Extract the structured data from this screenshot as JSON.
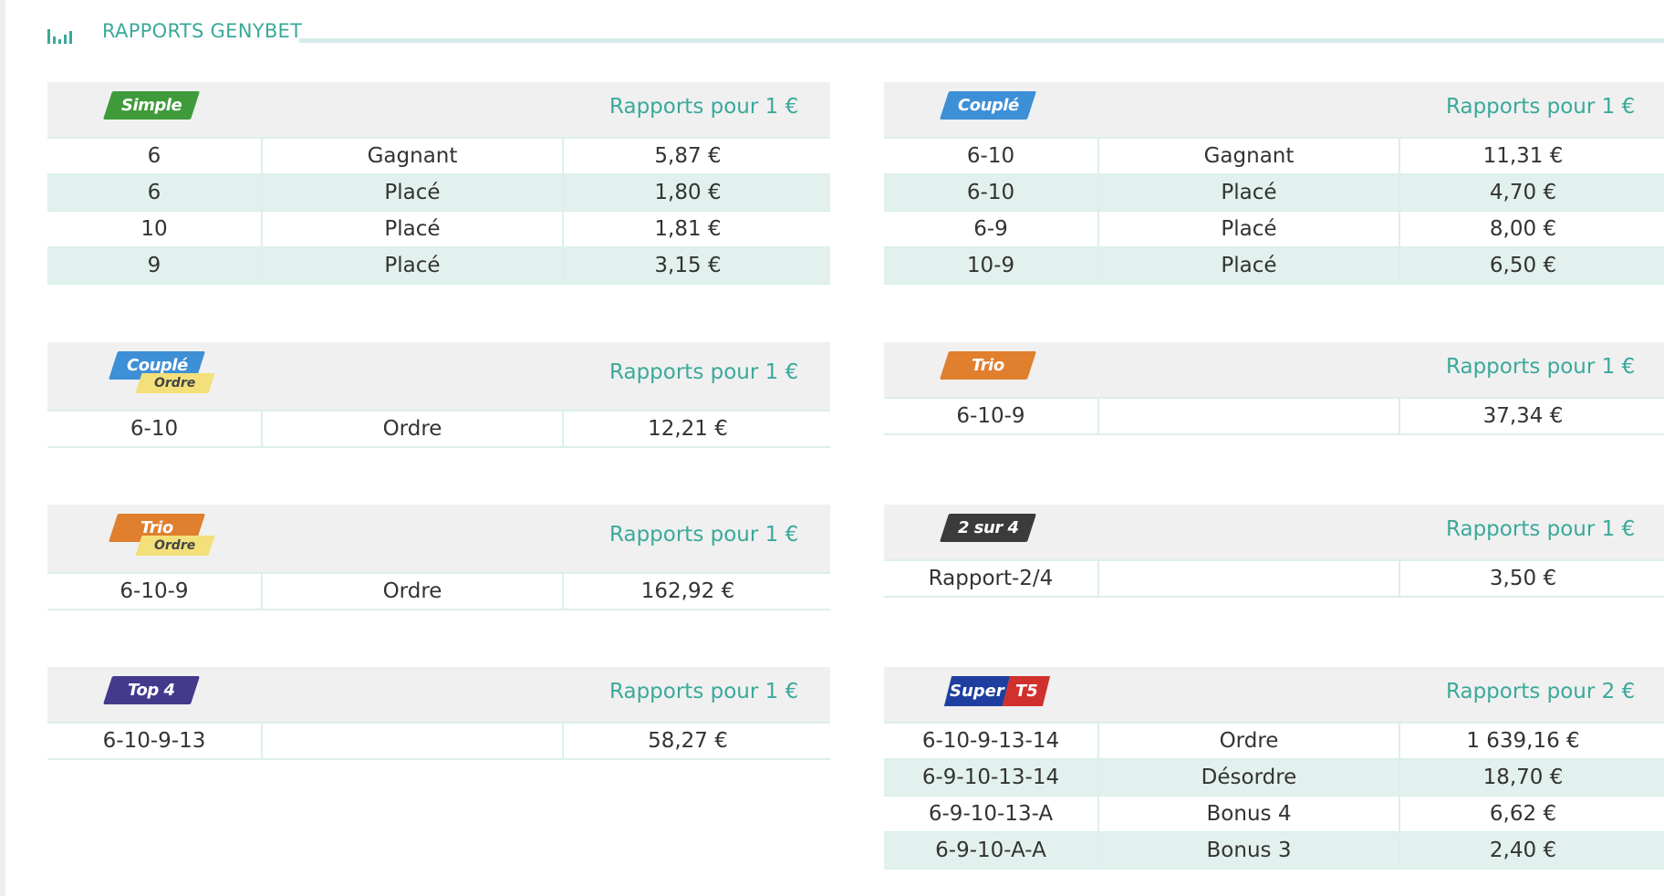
{
  "header": {
    "title": "RAPPORTS GENYBET",
    "icon": "chart-bars-icon"
  },
  "colors": {
    "accent": "#3aa99a",
    "row_alt": "#e3f1ee",
    "head_bg": "#f0f0f0"
  },
  "blocks": {
    "simple": {
      "badge": "Simple",
      "rapports": "Rapports pour 1 €",
      "rows": [
        [
          "6",
          "Gagnant",
          "5,87 €"
        ],
        [
          "6",
          "Placé",
          "1,80 €"
        ],
        [
          "10",
          "Placé",
          "1,81 €"
        ],
        [
          "9",
          "Placé",
          "3,15 €"
        ]
      ]
    },
    "couple": {
      "badge": "Couplé",
      "rapports": "Rapports pour 1 €",
      "rows": [
        [
          "6-10",
          "Gagnant",
          "11,31 €"
        ],
        [
          "6-10",
          "Placé",
          "4,70 €"
        ],
        [
          "6-9",
          "Placé",
          "8,00 €"
        ],
        [
          "10-9",
          "Placé",
          "6,50 €"
        ]
      ]
    },
    "couple_ordre": {
      "badge": "Couplé",
      "badge_sub": "Ordre",
      "rapports": "Rapports pour 1 €",
      "rows": [
        [
          "6-10",
          "Ordre",
          "12,21 €"
        ]
      ]
    },
    "trio": {
      "badge": "Trio",
      "rapports": "Rapports pour 1 €",
      "rows": [
        [
          "6-10-9",
          "",
          "37,34 €"
        ]
      ]
    },
    "trio_ordre": {
      "badge": "Trio",
      "badge_sub": "Ordre",
      "rapports": "Rapports pour 1 €",
      "rows": [
        [
          "6-10-9",
          "Ordre",
          "162,92 €"
        ]
      ]
    },
    "deux_sur_quatre": {
      "badge": "2 sur 4",
      "rapports": "Rapports pour 1 €",
      "rows": [
        [
          "Rapport-2/4",
          "",
          "3,50 €"
        ]
      ]
    },
    "top4": {
      "badge": "Top 4",
      "rapports": "Rapports pour 1 €",
      "rows": [
        [
          "6-10-9-13",
          "",
          "58,27 €"
        ]
      ]
    },
    "super_t5": {
      "badge_part1": "Super",
      "badge_part2": "T5",
      "rapports": "Rapports pour 2 €",
      "rows": [
        [
          "6-10-9-13-14",
          "Ordre",
          "1 639,16 €"
        ],
        [
          "6-9-10-13-14",
          "Désordre",
          "18,70 €"
        ],
        [
          "6-9-10-13-A",
          "Bonus 4",
          "6,62 €"
        ],
        [
          "6-9-10-A-A",
          "Bonus 3",
          "2,40 €"
        ]
      ]
    }
  }
}
